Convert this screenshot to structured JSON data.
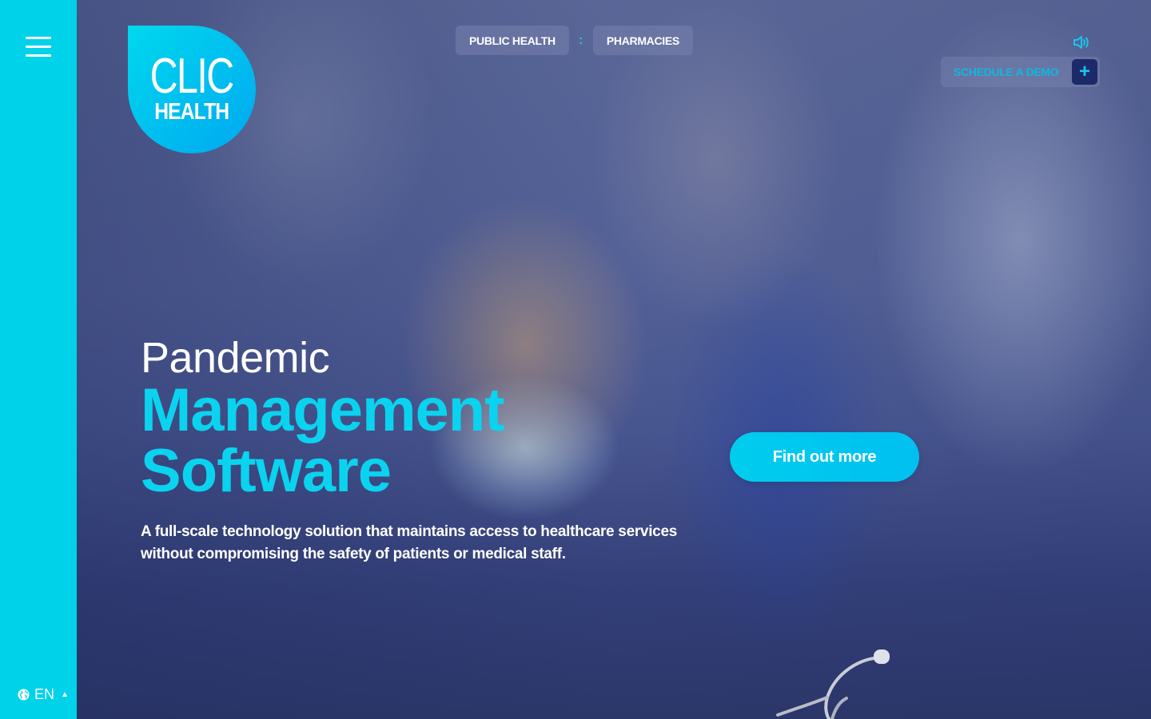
{
  "brand": {
    "logo_line1": "CLIC",
    "logo_line2": "HEALTH",
    "accent": "#00d2ea",
    "dark": "#2b3566"
  },
  "sidebar": {
    "menu_icon": "hamburger-menu-icon",
    "language": "EN",
    "language_icon": "globe-icon",
    "language_caret": "▲"
  },
  "topnav": {
    "items": [
      {
        "label": "PUBLIC HEALTH"
      },
      {
        "label": "PHARMACIES"
      }
    ],
    "separator": ":"
  },
  "header_actions": {
    "sound_icon": "speaker-icon",
    "demo_label": "SCHEDULE A DEMO",
    "demo_plus": "+"
  },
  "hero": {
    "title_line1": "Pandemic",
    "title_line2": "Management",
    "title_line3": "Software",
    "description": "A full-scale technology solution that maintains access to healthcare services without compromising the safety of patients or medical staff.",
    "cta_label": "Find out more"
  }
}
